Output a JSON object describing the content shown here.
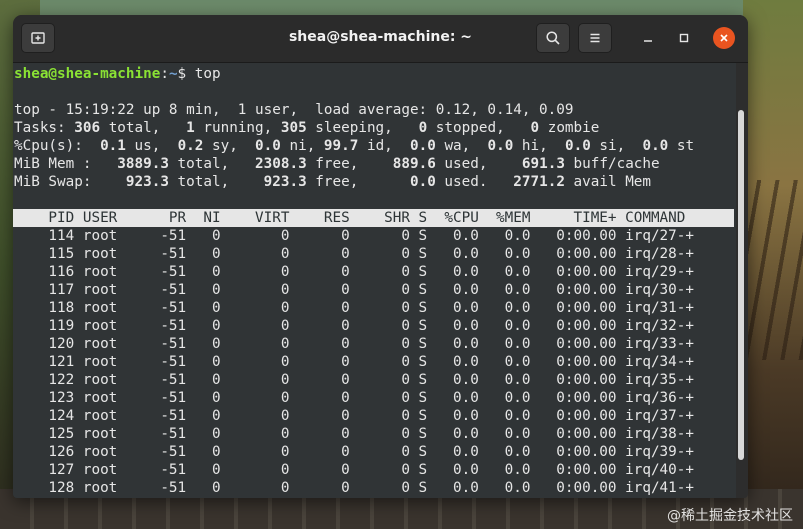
{
  "window": {
    "title": "shea@shea-machine: ~"
  },
  "prompt": {
    "user_host": "shea@shea-machine",
    "sep": ":",
    "path": "~",
    "symbol": "$",
    "command": "top"
  },
  "summary": {
    "line1": "top - 15:19:22 up 8 min,  1 user,  load average: 0.12, 0.14, 0.09",
    "tasks": {
      "prefix": "Tasks: ",
      "total": "306",
      "total_label": " total,   ",
      "running": "1",
      "running_label": " running, ",
      "sleeping": "305",
      "sleeping_label": " sleeping,   ",
      "stopped": "0",
      "stopped_label": " stopped,   ",
      "zombie": "0",
      "zombie_label": " zombie"
    },
    "cpu": {
      "prefix": "%Cpu(s):  ",
      "us": "0.1",
      "us_label": " us,  ",
      "sy": "0.2",
      "sy_label": " sy,  ",
      "ni": "0.0",
      "ni_label": " ni, ",
      "id": "99.7",
      "id_label": " id,  ",
      "wa": "0.0",
      "wa_label": " wa,  ",
      "hi": "0.0",
      "hi_label": " hi,  ",
      "si": "0.0",
      "si_label": " si,  ",
      "st": "0.0",
      "st_label": " st"
    },
    "mem": {
      "prefix": "MiB Mem :   ",
      "total": "3889.3",
      "total_label": " total,   ",
      "free": "2308.3",
      "free_label": " free,    ",
      "used": "889.6",
      "used_label": " used,    ",
      "buff": "691.3",
      "buff_label": " buff/cache"
    },
    "swap": {
      "prefix": "MiB Swap:    ",
      "total": "923.3",
      "total_label": " total,    ",
      "free": "923.3",
      "free_label": " free,      ",
      "used": "0.0",
      "used_label": " used.   ",
      "avail": "2771.2",
      "avail_label": " avail Mem"
    }
  },
  "table": {
    "header": "    PID USER      PR  NI    VIRT    RES    SHR S  %CPU  %MEM     TIME+ COMMAND  ",
    "rows": [
      "    114 root     -51   0       0      0      0 S   0.0   0.0   0:00.00 irq/27-+",
      "    115 root     -51   0       0      0      0 S   0.0   0.0   0:00.00 irq/28-+",
      "    116 root     -51   0       0      0      0 S   0.0   0.0   0:00.00 irq/29-+",
      "    117 root     -51   0       0      0      0 S   0.0   0.0   0:00.00 irq/30-+",
      "    118 root     -51   0       0      0      0 S   0.0   0.0   0:00.00 irq/31-+",
      "    119 root     -51   0       0      0      0 S   0.0   0.0   0:00.00 irq/32-+",
      "    120 root     -51   0       0      0      0 S   0.0   0.0   0:00.00 irq/33-+",
      "    121 root     -51   0       0      0      0 S   0.0   0.0   0:00.00 irq/34-+",
      "    122 root     -51   0       0      0      0 S   0.0   0.0   0:00.00 irq/35-+",
      "    123 root     -51   0       0      0      0 S   0.0   0.0   0:00.00 irq/36-+",
      "    124 root     -51   0       0      0      0 S   0.0   0.0   0:00.00 irq/37-+",
      "    125 root     -51   0       0      0      0 S   0.0   0.0   0:00.00 irq/38-+",
      "    126 root     -51   0       0      0      0 S   0.0   0.0   0:00.00 irq/39-+",
      "    127 root     -51   0       0      0      0 S   0.0   0.0   0:00.00 irq/40-+",
      "    128 root     -51   0       0      0      0 S   0.0   0.0   0:00.00 irq/41-+"
    ]
  },
  "watermark": "@稀土掘金技术社区",
  "icons": {
    "new_tab": "new-tab-icon",
    "search": "search-icon",
    "menu": "hamburger-menu-icon",
    "minimize": "minimize-icon",
    "maximize": "maximize-icon",
    "close": "close-icon"
  },
  "colors": {
    "terminal_bg": "#303436",
    "prompt_user": "#8ae234",
    "prompt_path": "#729fcf",
    "close_button": "#e95420"
  }
}
